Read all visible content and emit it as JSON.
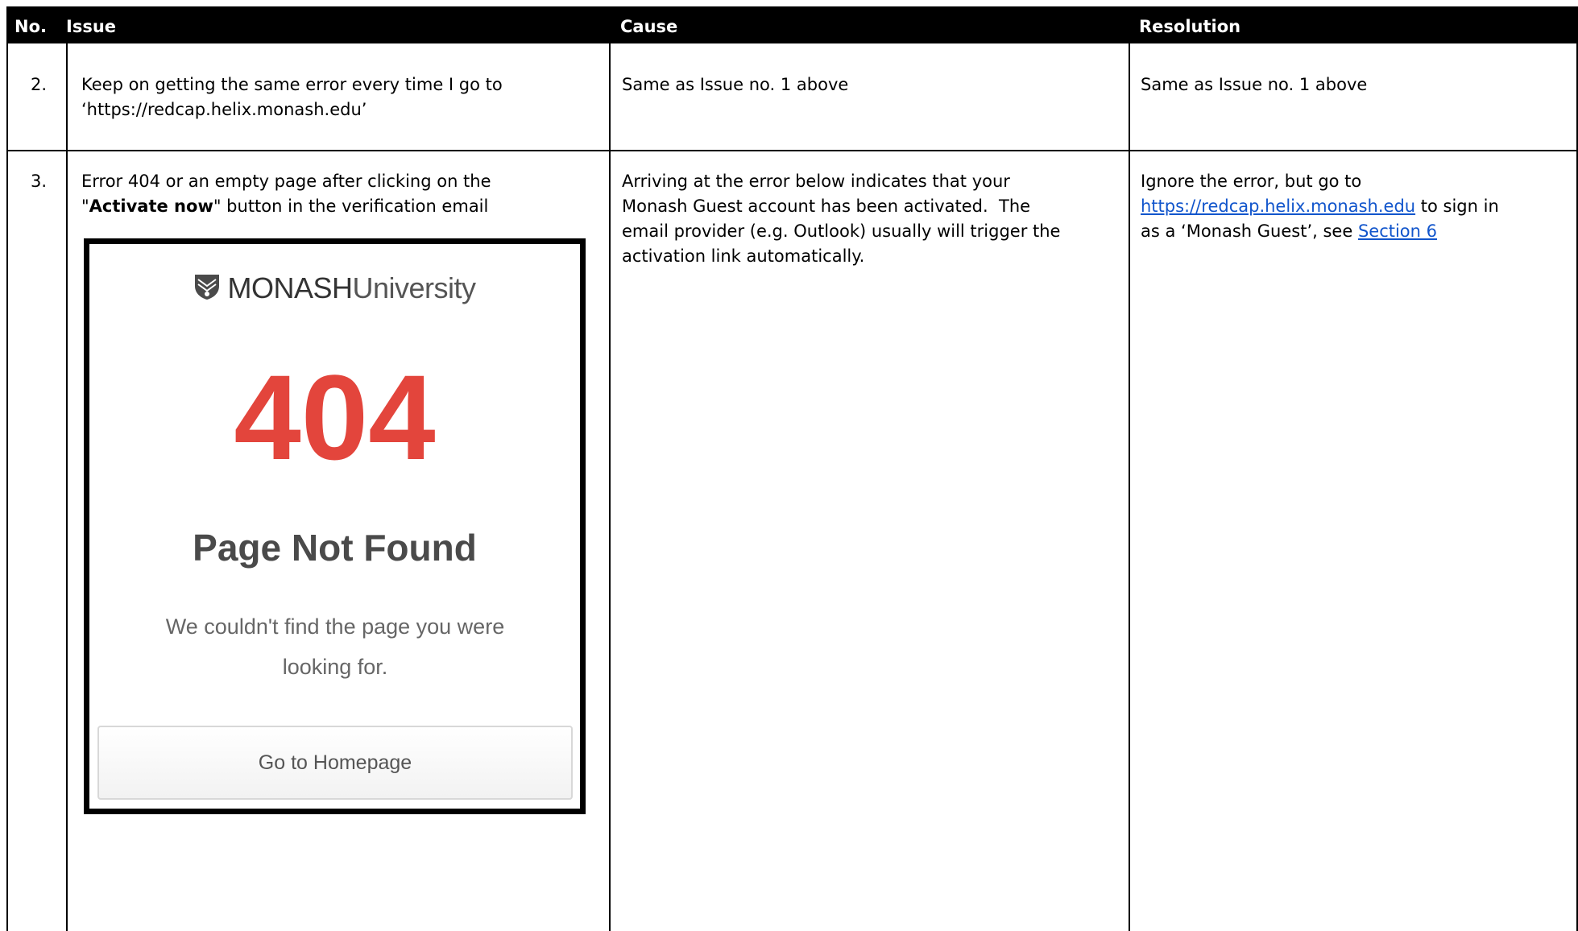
{
  "headers": {
    "no": "No.",
    "issue": "Issue",
    "cause": "Cause",
    "resolution": "Resolution"
  },
  "rows": [
    {
      "no": "2.",
      "issue_line1": "Keep on getting the same error every time I go to",
      "issue_line2": "‘https://redcap.helix.monash.edu’",
      "cause": "Same as Issue no. 1 above",
      "resolution": "Same as Issue no. 1 above"
    },
    {
      "no": "3.",
      "issue_line1": "Error 404 or an empty page after clicking on the",
      "issue_line2_pre": "\"",
      "issue_line2_bold": "Activate now",
      "issue_line2_post": "\" button in the verification email",
      "cause_lines": [
        "Arriving at the error below indicates that your",
        "Monash Guest account has been activated.  The",
        "email provider (e.g. Outlook) usually will trigger the",
        "activation link automatically."
      ],
      "resolution_line1": "Ignore the error, but go to",
      "resolution_link": "https://redcap.helix.monash.edu",
      "resolution_after_link": " to sign in",
      "resolution_line3_pre": "as a ‘Monash Guest’, see ",
      "resolution_section_link": "Section 6"
    }
  ],
  "error_page": {
    "logo_bold": "MONASH",
    "logo_light": "University",
    "code": "404",
    "title": "Page Not Found",
    "message_line1": "We couldn't find the page you were",
    "message_line2": "looking for.",
    "button": "Go to Homepage",
    "code_color": "#e3453c"
  }
}
